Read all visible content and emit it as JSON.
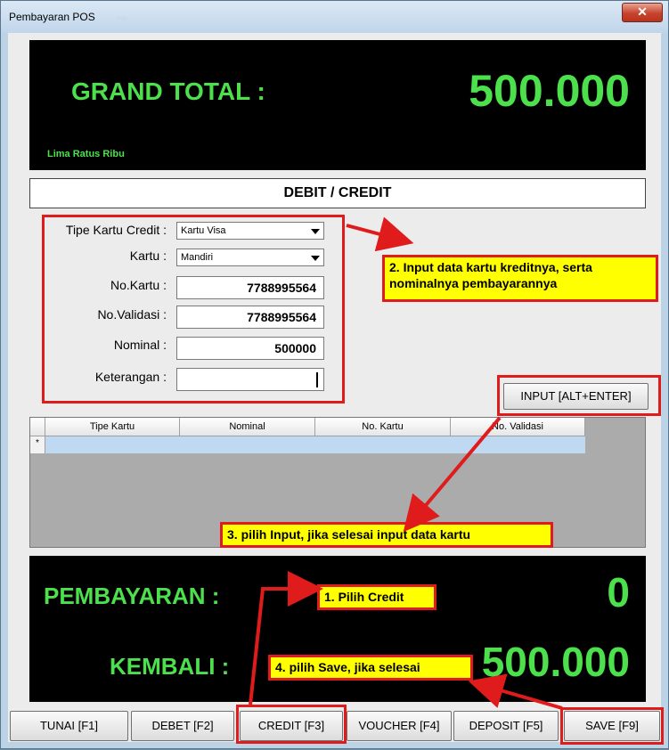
{
  "window": {
    "title": "Pembayaran POS",
    "background_ghost": "...",
    "close_glyph": "✕"
  },
  "grand_total": {
    "label": "GRAND TOTAL :",
    "value": "500.000",
    "words": "Lima Ratus Ribu"
  },
  "section_header": "DEBIT / CREDIT",
  "form": {
    "tipe_kartu_label": "Tipe Kartu Credit :",
    "tipe_kartu_value": "Kartu Visa",
    "kartu_label": "Kartu :",
    "kartu_value": "Mandiri",
    "no_kartu_label": "No.Kartu :",
    "no_kartu_value": "7788995564",
    "no_validasi_label": "No.Validasi :",
    "no_validasi_value": "7788995564",
    "nominal_label": "Nominal :",
    "nominal_value": "500000",
    "keterangan_label": "Keterangan :",
    "keterangan_value": ""
  },
  "input_button": "INPUT [ALT+ENTER]",
  "grid": {
    "columns": [
      "Tipe Kartu",
      "Nominal",
      "No. Kartu",
      "No. Validasi"
    ],
    "new_row_marker": "*"
  },
  "pembayaran": {
    "label": "PEMBAYARAN :",
    "value": "0"
  },
  "kembali": {
    "label": "KEMBALI :",
    "value": "500.000"
  },
  "buttons": {
    "tunai": "TUNAI [F1]",
    "debet": "DEBET [F2]",
    "credit": "CREDIT [F3]",
    "voucher": "VOUCHER [F4]",
    "deposit": "DEPOSIT [F5]",
    "save": "SAVE [F9]"
  },
  "annotations": {
    "step1": "1. Pilih Credit",
    "step2_line1": "2. Input data kartu kreditnya, serta",
    "step2_line2": "nominalnya pembayarannya",
    "step3": "3. pilih Input, jika selesai input data kartu",
    "step4": "4. pilih Save, jika selesai"
  },
  "colors": {
    "green_text": "#4ce04c",
    "annotation_red": "#e01b1b",
    "annotation_yellow": "#ffff00"
  }
}
